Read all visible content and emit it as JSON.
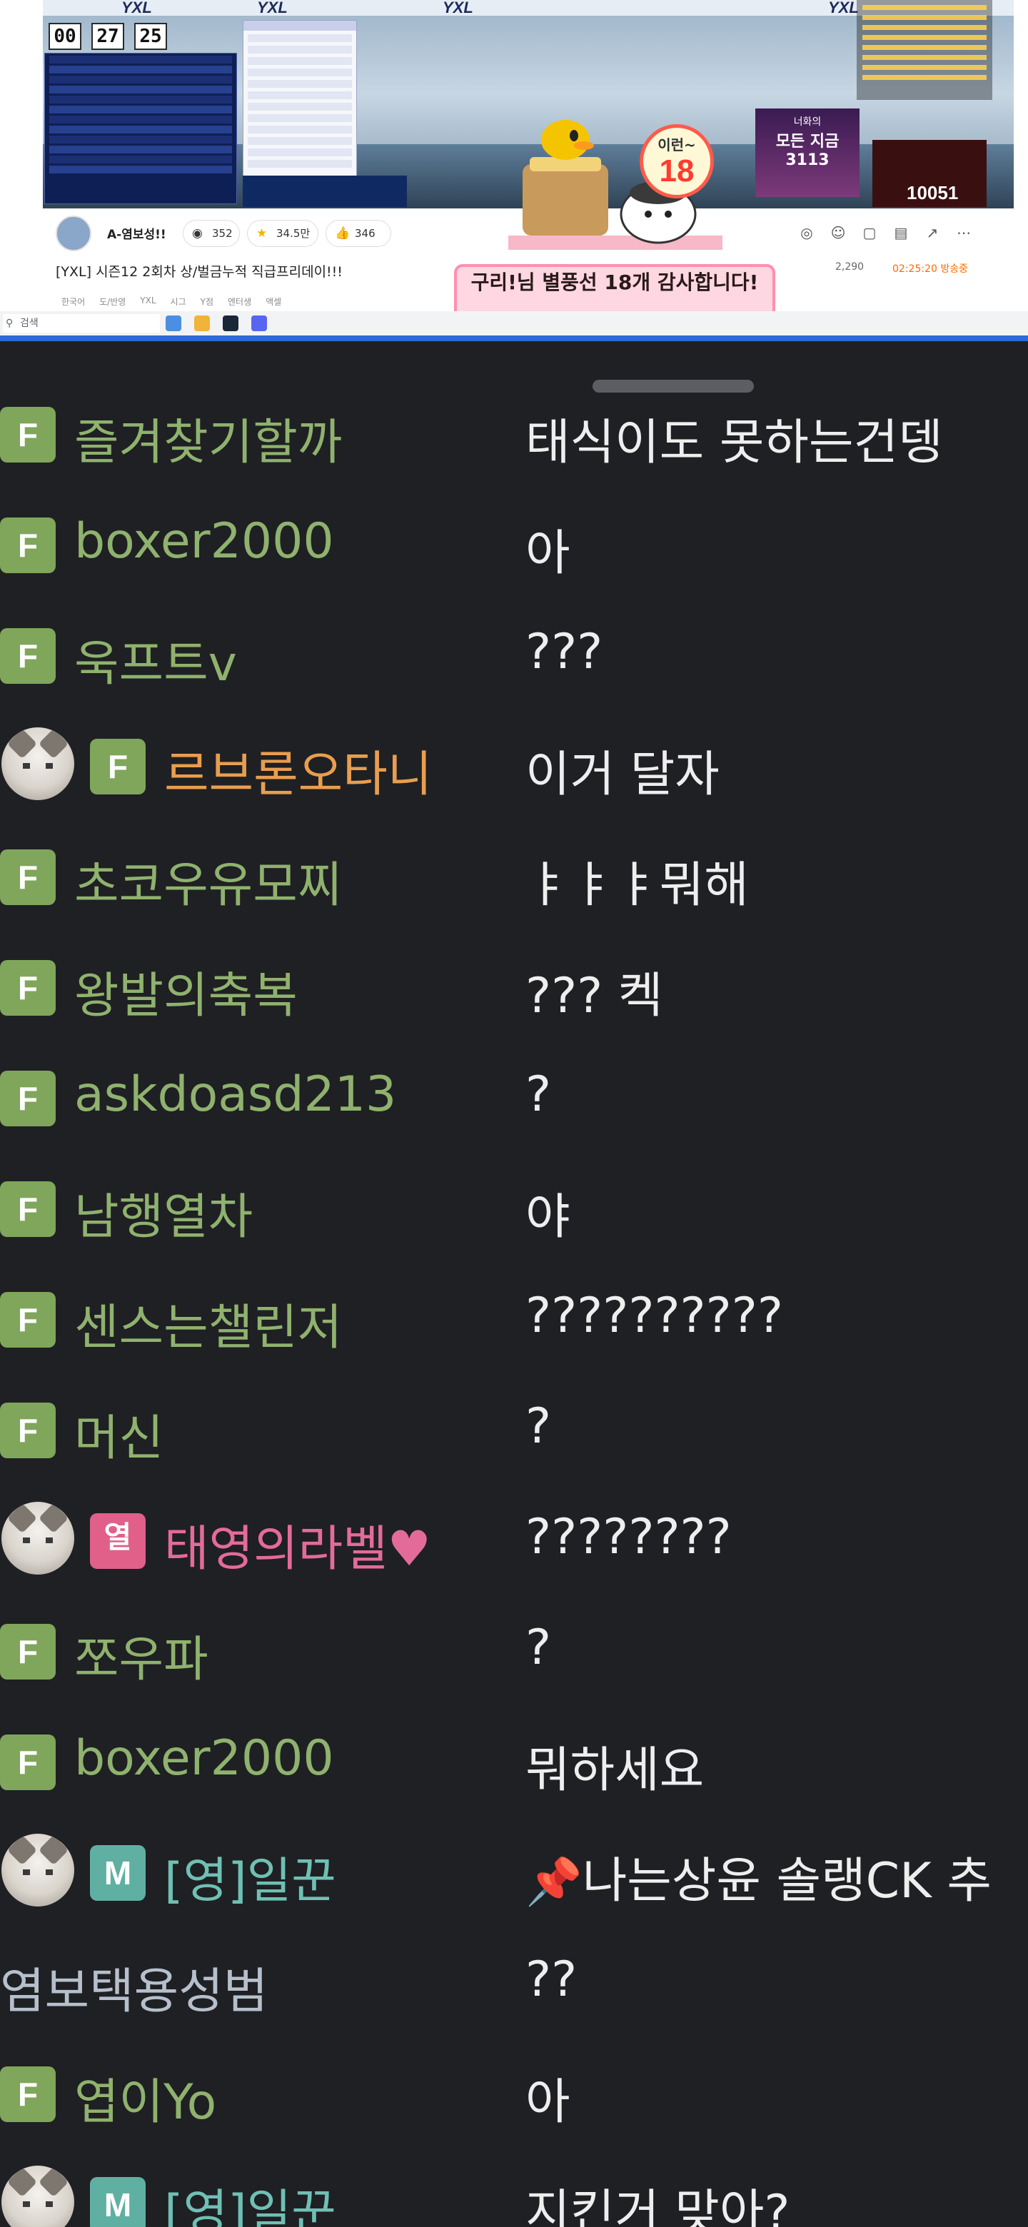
{
  "stream": {
    "video_title_overlay": "YXL",
    "clock": [
      "00",
      "27",
      "25"
    ],
    "gift_banner": "구리!님 별풍선 18개 감사합니다!",
    "mascot": {
      "burst_top": "이런~",
      "burst_number": "18"
    },
    "promo": {
      "line1": "너화의",
      "line2": "모든 지금",
      "line3": "3113"
    },
    "cam_counter": "10051",
    "streamer_name": "A-염보성!!",
    "views_pill": "352",
    "star_pill": "34.5만",
    "like_pill": "346",
    "title": "[YXL] 시즌12 2회차 상/벌금누적 직급프리데이!!!",
    "viewers": "2,290",
    "airtime": "02:25:20 방송중",
    "tags": [
      "한국어",
      "도/반영",
      "YXL",
      "시그",
      "Y점",
      "엔터생",
      "액셀"
    ],
    "taskbar_search": "검색",
    "icons": [
      "record-icon",
      "chat-icon",
      "note-icon",
      "calendar-icon",
      "share-icon",
      "more-icon"
    ]
  },
  "chat": {
    "messages": [
      {
        "badge": "F",
        "avatar": false,
        "nick": "즐겨찾기할까",
        "color": "green",
        "text": "태식이도 못하는건뎅"
      },
      {
        "badge": "F",
        "avatar": false,
        "nick": "boxer2000",
        "color": "green",
        "text": "아"
      },
      {
        "badge": "F",
        "avatar": false,
        "nick": "욱프트v",
        "color": "green",
        "text": "???"
      },
      {
        "badge": "F",
        "avatar": true,
        "nick": "르브론오타니",
        "color": "orange",
        "text": "이거 달자"
      },
      {
        "badge": "F",
        "avatar": false,
        "nick": "초코우유모찌",
        "color": "green",
        "text": "ㅑㅑㅑ뭐해"
      },
      {
        "badge": "F",
        "avatar": false,
        "nick": "왕발의축복",
        "color": "green",
        "text": "??? 켁"
      },
      {
        "badge": "F",
        "avatar": false,
        "nick": "askdoasd213",
        "color": "green",
        "text": "?"
      },
      {
        "badge": "F",
        "avatar": false,
        "nick": "남행열차",
        "color": "green",
        "text": "야"
      },
      {
        "badge": "F",
        "avatar": false,
        "nick": "센스는챌린저",
        "color": "green",
        "text": "??????????"
      },
      {
        "badge": "F",
        "avatar": false,
        "nick": "머신",
        "color": "green",
        "text": "?"
      },
      {
        "badge": "열",
        "avatar": true,
        "nick": "태영의라벨♥",
        "color": "pink",
        "text": "????????"
      },
      {
        "badge": "F",
        "avatar": false,
        "nick": "쪼우파",
        "color": "green",
        "text": "?"
      },
      {
        "badge": "F",
        "avatar": false,
        "nick": "boxer2000",
        "color": "green",
        "text": "뭐하세요"
      },
      {
        "badge": "M",
        "avatar": true,
        "nick": "[영]일꾼",
        "color": "teal",
        "text": "나는상윤 솔랭CK 추",
        "pin": "📌"
      },
      {
        "badge": "",
        "avatar": false,
        "nick": "염보택용성범",
        "color": "gray",
        "text": "??"
      },
      {
        "badge": "F",
        "avatar": false,
        "nick": "엽이Yo",
        "color": "green",
        "text": "아"
      },
      {
        "badge": "M",
        "avatar": true,
        "nick": "[영]일꾼",
        "color": "teal",
        "text": "지킨거 맞아?"
      }
    ]
  },
  "colors": {
    "chat_bg": "#1f2023",
    "badge_f": "#7fa65a",
    "badge_m": "#5fb0a3",
    "badge_yeol": "#e0608a",
    "nick_green": "#8fb26e",
    "nick_orange": "#e89e4f",
    "nick_pink": "#e36b9a",
    "nick_teal": "#6fc0b4",
    "accent_blue": "#2b6ad8"
  }
}
